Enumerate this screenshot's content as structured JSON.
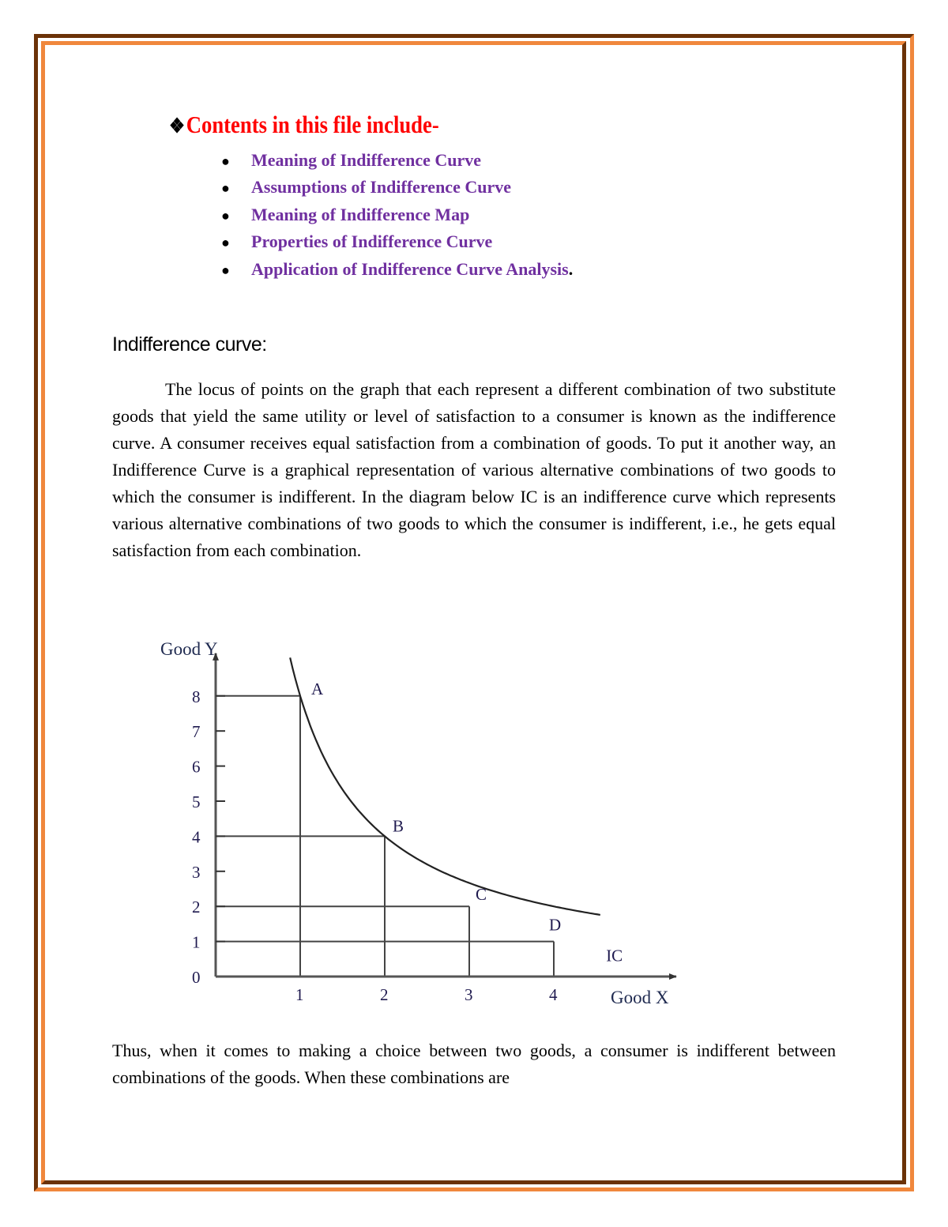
{
  "page_border": {
    "colors": {
      "dark": "#6b3208",
      "light": "#f0873c"
    }
  },
  "contents": {
    "heading_icon": "diamond-cluster-icon",
    "heading": "Contents in this file include-",
    "heading_color": "#ff0000",
    "item_color": "#7030a0",
    "items": [
      {
        "label": "Meaning of Indifference Curve",
        "suffix": ""
      },
      {
        "label": "Assumptions of Indifference Curve",
        "suffix": ""
      },
      {
        "label": "Meaning of Indifference Map",
        "suffix": ""
      },
      {
        "label": "Properties of Indifference Curve",
        "suffix": ""
      },
      {
        "label": "Application of Indifference Curve Analysis",
        "suffix": "."
      }
    ]
  },
  "section": {
    "title": "Indifference curve:",
    "paragraph_1": "The locus of points on the graph that each represent a different combination of two substitute goods that yield the same utility or level of satisfaction to a consumer is known as the indifference curve. A consumer receives equal satisfaction from a combination of goods. To put it another way, an Indifference Curve is a graphical representation of various alternative combinations of two goods to which the consumer is indifferent. In the diagram below IC is an indifference curve which represents various alternative combinations of two goods to which the consumer is indifferent, i.e., he gets equal satisfaction from each combination.",
    "paragraph_2": "Thus, when it comes to making a choice between two goods, a consumer is indifferent between combinations of the goods. When these combinations are"
  },
  "chart_data": {
    "type": "line",
    "title": "",
    "xlabel": "Good X",
    "ylabel": "Good Y",
    "xlim": [
      0,
      4.7
    ],
    "ylim": [
      0,
      8.9
    ],
    "x_ticks": [
      0,
      1,
      2,
      3,
      4
    ],
    "y_ticks": [
      0,
      1,
      2,
      3,
      4,
      5,
      6,
      7,
      8
    ],
    "x_tick_labels": [
      "1",
      "2",
      "3",
      "4"
    ],
    "y_tick_labels": [
      "0",
      "1",
      "2",
      "3",
      "4",
      "5",
      "6",
      "7",
      "8"
    ],
    "grid": false,
    "legend": "none",
    "series": [
      {
        "name": "IC",
        "description": "Indifference curve",
        "curve_range_x": [
          0.88,
          4.55
        ],
        "points": [
          {
            "label": "A",
            "x": 1,
            "y": 8
          },
          {
            "label": "B",
            "x": 2,
            "y": 4
          },
          {
            "label": "C",
            "x": 3,
            "y": 2
          },
          {
            "label": "D",
            "x": 4,
            "y": 1
          }
        ]
      }
    ],
    "annotations": [
      {
        "text": "IC",
        "x": 4.6,
        "y": 0.62
      }
    ]
  }
}
